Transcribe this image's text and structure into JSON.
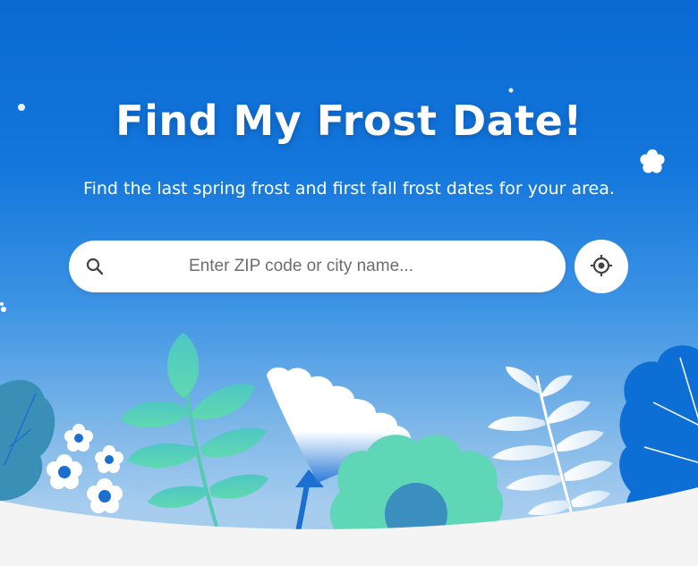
{
  "hero": {
    "title": "Find My Frost Date!",
    "subtitle": "Find the last spring frost and first fall frost dates for your area."
  },
  "search": {
    "placeholder": "Enter ZIP code or city name...",
    "value": "",
    "icon": "search-icon"
  },
  "locate": {
    "icon": "crosshair-icon"
  },
  "colors": {
    "background_top": "#0a69d3",
    "background_bottom": "#a7cdee",
    "ground": "#f4f4f4",
    "leaf_teal": "#5cd3b4",
    "leaf_blue": "#0d6fd6",
    "flower_center": "#1a6fd0"
  }
}
